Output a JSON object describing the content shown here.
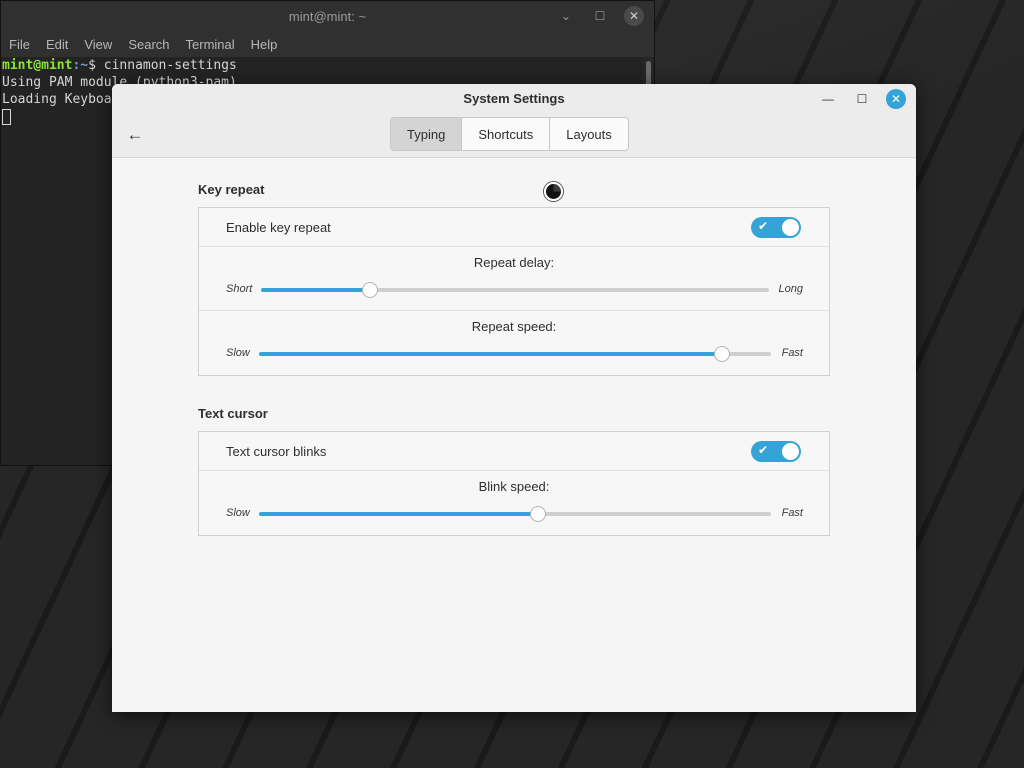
{
  "terminal": {
    "title": "mint@mint: ~",
    "controls": {
      "minimize": "⌄",
      "maximize": "☐",
      "close": "✕"
    },
    "menu": [
      "File",
      "Edit",
      "View",
      "Search",
      "Terminal",
      "Help"
    ],
    "prompt_user": "mint@mint",
    "prompt_path": ":~",
    "prompt_symbol": "$ ",
    "command": "cinnamon-settings",
    "lines": [
      "Using PAM module (python3-pam)",
      "Loading Keyboard module"
    ]
  },
  "settings": {
    "title": "System Settings",
    "controls": {
      "minimize": "—",
      "maximize": "☐",
      "close": "✕"
    },
    "back_icon": "←",
    "tabs": [
      {
        "label": "Typing",
        "active": true
      },
      {
        "label": "Shortcuts",
        "active": false
      },
      {
        "label": "Layouts",
        "active": false
      }
    ],
    "key_repeat": {
      "title": "Key repeat",
      "enable_label": "Enable key repeat",
      "enabled": true,
      "delay": {
        "label": "Repeat delay:",
        "min_label": "Short",
        "max_label": "Long",
        "value": 0.215
      },
      "speed": {
        "label": "Repeat speed:",
        "min_label": "Slow",
        "max_label": "Fast",
        "value": 0.905
      }
    },
    "text_cursor": {
      "title": "Text cursor",
      "blink_label": "Text cursor blinks",
      "enabled": true,
      "blink_speed": {
        "label": "Blink speed:",
        "min_label": "Slow",
        "max_label": "Fast",
        "value": 0.545
      }
    },
    "switch_check_icon": "✔",
    "accent_color": "#35a3d8"
  }
}
